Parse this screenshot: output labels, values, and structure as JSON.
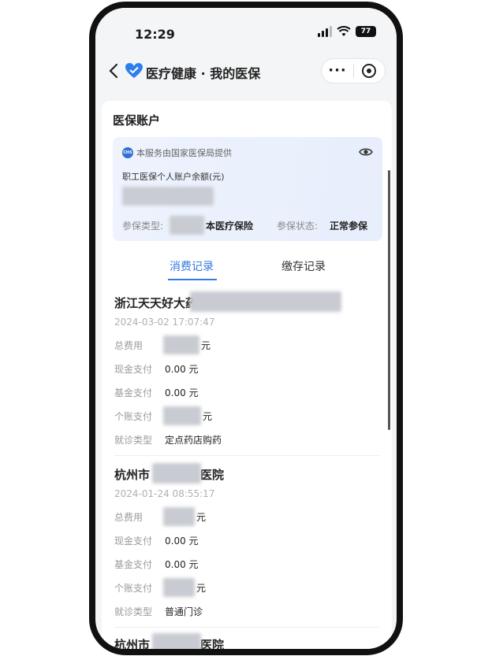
{
  "status_bar": {
    "time": "12:29",
    "battery": "77"
  },
  "nav": {
    "title": "医疗健康 · 我的医保"
  },
  "account": {
    "section_title": "医保账户",
    "provider": "本服务由国家医保局提供",
    "provider_badge": "CHS",
    "balance_label": "职工医保个人账户余额(元)",
    "insurance_type_label": "参保类型:",
    "insurance_type_value": "本医疗保险",
    "status_label": "参保状态:",
    "status_value": "正常参保"
  },
  "tabs": {
    "consumption": "消费记录",
    "payment": "缴存记录"
  },
  "records": [
    {
      "title": "浙江天天好大药",
      "time": "2024-03-02 17:07:47",
      "total_label": "总费用",
      "total_unit": "元",
      "cash_label": "现金支付",
      "cash_value": "0.00 元",
      "fund_label": "基金支付",
      "fund_value": "0.00 元",
      "personal_label": "个账支付",
      "personal_unit": "元",
      "visit_type_label": "就诊类型",
      "visit_type_value": "定点药店购药"
    },
    {
      "title_prefix": "杭州市",
      "title_suffix": "医院",
      "time": "2024-01-24 08:55:17",
      "total_label": "总费用",
      "total_unit": "元",
      "cash_label": "现金支付",
      "cash_value": "0.00 元",
      "fund_label": "基金支付",
      "fund_value": "0.00 元",
      "personal_label": "个账支付",
      "personal_unit": "元",
      "visit_type_label": "就诊类型",
      "visit_type_value": "普通门诊"
    },
    {
      "title_prefix": "杭州市",
      "title_suffix": "医院"
    }
  ]
}
